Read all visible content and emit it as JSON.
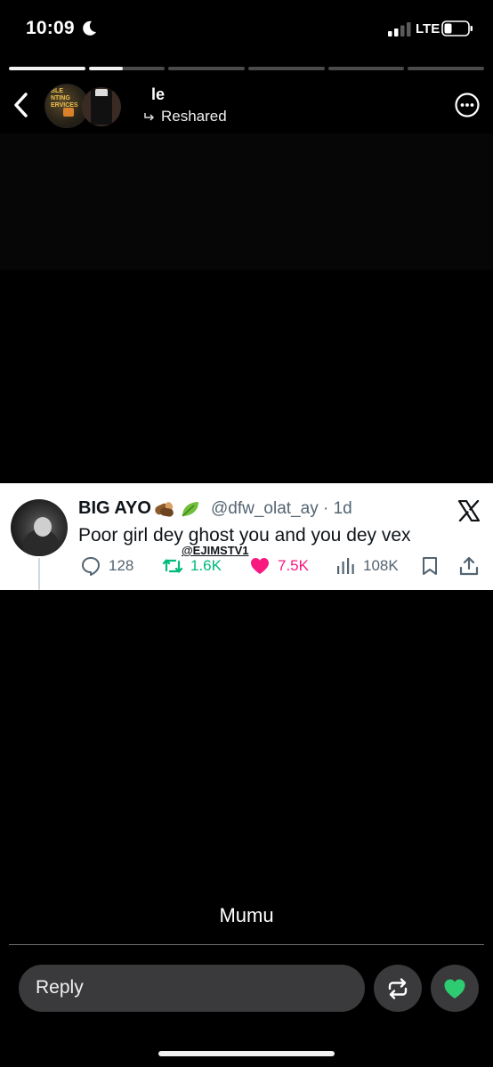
{
  "status_bar": {
    "time": "10:09",
    "network": "LTE",
    "icons": [
      "moon-icon",
      "signal-icon",
      "battery-icon"
    ]
  },
  "story_progress": {
    "segment_count": 6,
    "fills": [
      1.0,
      0.45,
      0,
      0,
      0,
      0
    ]
  },
  "header": {
    "username": "le",
    "reshared_label": "Reshared",
    "icons": [
      "chevron-left-icon",
      "reshare-icon",
      "more-options-icon"
    ]
  },
  "tweet": {
    "display_name": "BIG AYO",
    "name_emojis": [
      "wood-log-emoji",
      "leaf-emoji"
    ],
    "handle_time": "@dfw_olat_ay · 1d",
    "text": "Poor girl dey ghost you and you dey vex",
    "watermark": "@EJIMSTV1",
    "stats": {
      "replies": "128",
      "reposts": "1.6K",
      "likes": "7.5K",
      "views": "108K"
    },
    "colors": {
      "repost": "#00ba7c",
      "like": "#f91880",
      "muted": "#536471"
    },
    "icons": [
      "x-logo-icon",
      "reply-icon",
      "repost-icon",
      "heart-icon",
      "views-icon",
      "bookmark-icon",
      "share-icon"
    ]
  },
  "caption": "Mumu",
  "footer": {
    "reply_placeholder": "Reply",
    "like_color": "#2ecc71",
    "icons": [
      "repost-icon",
      "heart-icon"
    ]
  }
}
